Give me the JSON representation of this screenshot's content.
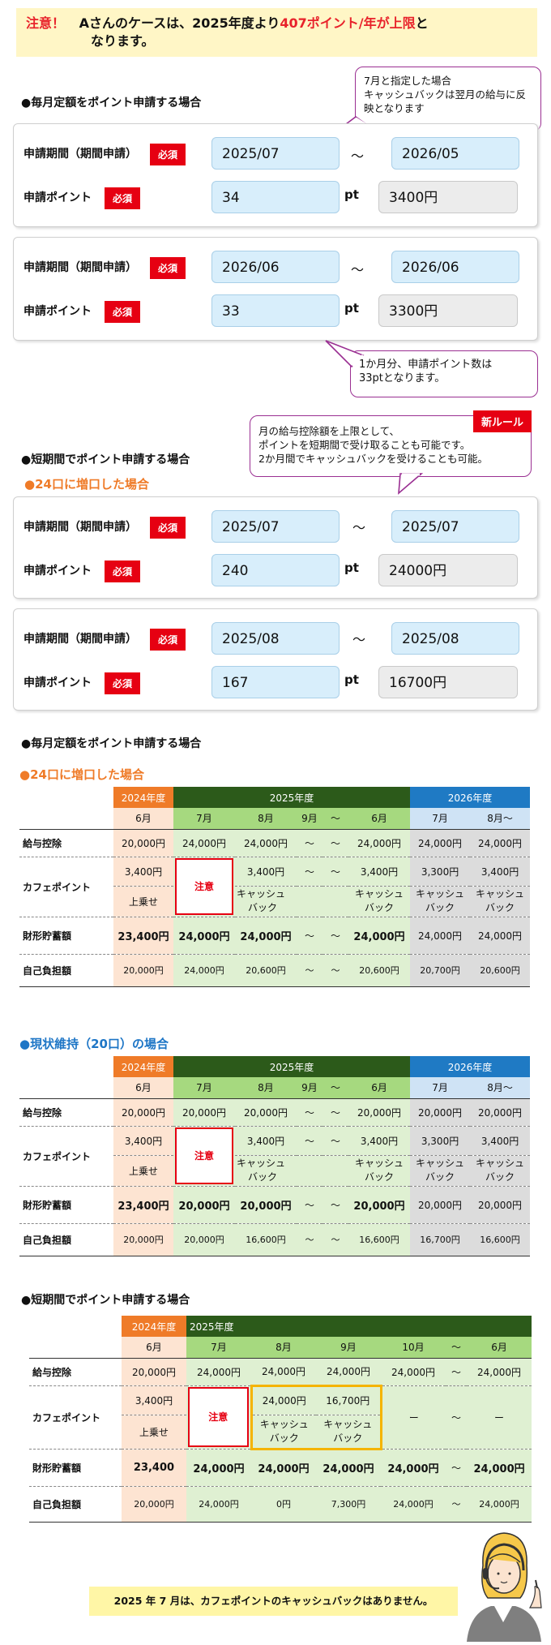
{
  "notice": {
    "prefix": "注意！",
    "text1": "Aさんのケースは、2025年度より",
    "highlight": "407ポイント/年が上限",
    "text2": "と",
    "text3": "なります。"
  },
  "section_monthly": "●毎月定額をポイント申請する場合",
  "callout_july": "7月と指定した場合\nキャッシュバックは翌月の給与に反映となります",
  "form": {
    "period_label": "申請期間（期間申請）",
    "points_label": "申請ポイント",
    "required": "必須",
    "tilde": "〜",
    "pt": "pt"
  },
  "monthly_a": {
    "from": "2025/07",
    "to": "2026/05",
    "points": "34",
    "yen": "3400円"
  },
  "monthly_b": {
    "from": "2026/06",
    "to": "2026/06",
    "points": "33",
    "yen": "3300円"
  },
  "callout_onemonth": "1か月分、申請ポイント数は\n33ptとなります。",
  "section_short": "●短期間でポイント申請する場合",
  "sub_24": "●24口に増口した場合",
  "new_rule": "新ルール",
  "callout_new": "月の給与控除額を上限として、\nポイントを短期間で受け取ることも可能です。\n2か月間でキャッシュバックを受けることも可能。",
  "short_a": {
    "from": "2025/07",
    "to": "2025/07",
    "points": "240",
    "yen": "24000円"
  },
  "short_b": {
    "from": "2025/08",
    "to": "2025/08",
    "points": "167",
    "yen": "16700円"
  },
  "section_monthly2": "●毎月定額をポイント申請する場合",
  "sub_20": "●現状維持（20口）の場合",
  "section_short2": "●短期間でポイント申請する場合",
  "table_labels": {
    "fy2024": "2024年度",
    "fy2025": "2025年度",
    "fy2026": "2026年度",
    "jun": "6月",
    "jul": "7月",
    "aug": "8月",
    "sep": "9月",
    "oct": "10月",
    "aug_on": "8月〜",
    "tilde": "〜",
    "salary": "給与控除",
    "cafe": "カフェポイント",
    "savings": "財形貯蓄額",
    "self": "自己負担額",
    "uwanose": "上乗せ",
    "caution": "注意",
    "cash1": "キャッシュ",
    "cash2": "バック",
    "dash": "ー"
  },
  "table1": {
    "salary": [
      "20,000円",
      "24,000円",
      "24,000円",
      "24,000円",
      "24,000円",
      "24,000円"
    ],
    "cafe": [
      "3,400円",
      "3,400円",
      "3,400円",
      "3,300円",
      "3,400円"
    ],
    "savings": [
      "23,400円",
      "24,000円",
      "24,000円",
      "24,000円",
      "24,000円",
      "24,000円"
    ],
    "self": [
      "20,000円",
      "24,000円",
      "20,600円",
      "20,600円",
      "20,700円",
      "20,600円"
    ]
  },
  "table2": {
    "salary": [
      "20,000円",
      "20,000円",
      "20,000円",
      "20,000円",
      "20,000円",
      "20,000円"
    ],
    "cafe": [
      "3,400円",
      "3,400円",
      "3,400円",
      "3,300円",
      "3,400円"
    ],
    "savings": [
      "23,400円",
      "20,000円",
      "20,000円",
      "20,000円",
      "20,000円",
      "20,000円"
    ],
    "self": [
      "20,000円",
      "20,000円",
      "16,600円",
      "16,600円",
      "16,700円",
      "16,600円"
    ]
  },
  "table3": {
    "salary": [
      "20,000円",
      "24,000円",
      "24,000円",
      "24,000円",
      "24,000円",
      "24,000円"
    ],
    "cafe": [
      "3,400円",
      "24,000円",
      "16,700円"
    ],
    "savings": [
      "23,400",
      "24,000円",
      "24,000円",
      "24,000円",
      "24,000円",
      "24,000円"
    ],
    "self": [
      "20,000円",
      "24,000円",
      "0円",
      "7,300円",
      "24,000円",
      "24,000円"
    ]
  },
  "footer": "2025 年 7 月は、カフェポイントのキャッシュバックはありません。"
}
